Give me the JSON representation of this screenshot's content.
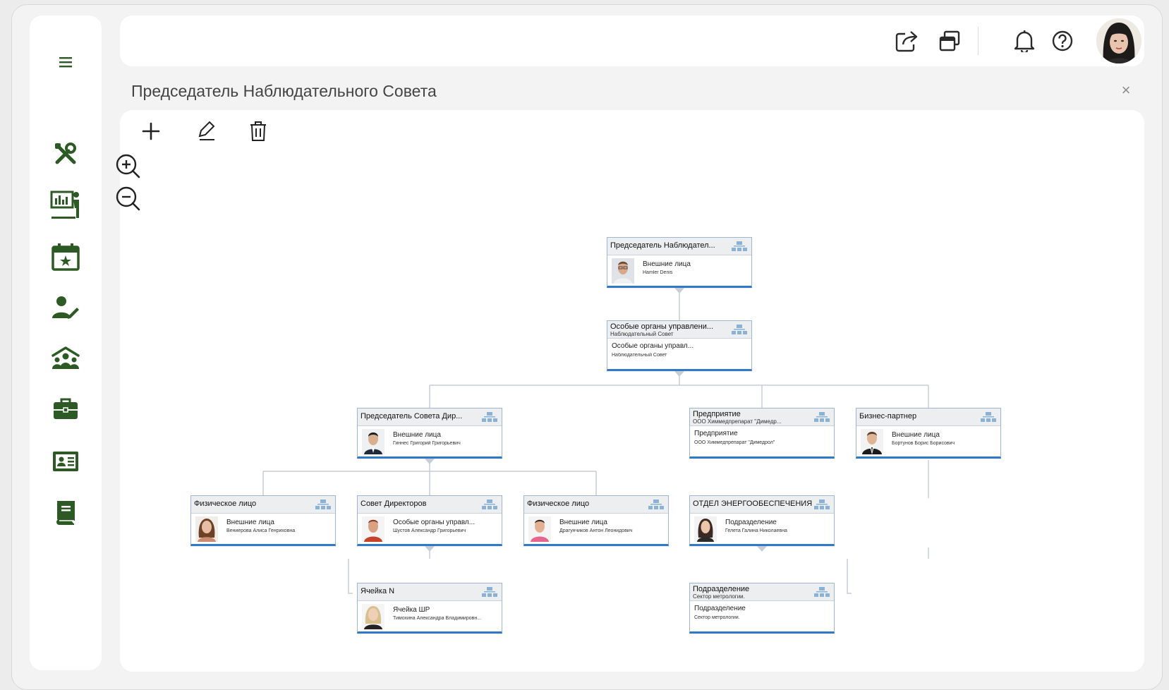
{
  "colors": {
    "icon_green": "#2d5a24",
    "node_border": "#2f79c8",
    "node_header": "#eceeef",
    "connector": "#c5cdd6"
  },
  "sidebar": {
    "items": [
      {
        "icon": "menu-icon"
      },
      {
        "icon": "tools-icon"
      },
      {
        "icon": "presentation-icon"
      },
      {
        "icon": "calendar-star-icon"
      },
      {
        "icon": "user-edit-icon"
      },
      {
        "icon": "organization-icon"
      },
      {
        "icon": "briefcase-icon"
      },
      {
        "icon": "id-card-icon"
      },
      {
        "icon": "book-icon"
      }
    ]
  },
  "topbar": {
    "icons": [
      "share-icon",
      "windows-icon",
      "bell-icon",
      "help-icon"
    ],
    "avatar": "user-avatar"
  },
  "page": {
    "title": "Председатель Наблюдательного Совета",
    "close_icon": "×"
  },
  "toolbar": {
    "icons": [
      "add-icon",
      "edit-icon",
      "delete-icon",
      "zoom-in-icon",
      "zoom-out-icon"
    ]
  },
  "org_chart": {
    "nodes": [
      {
        "id": "chairman-supervisory",
        "title": "Председатель Наблюдател...",
        "subtitle": "",
        "role": "Внешние лица",
        "name": "Hamler Denis",
        "photo": "man-glasses"
      },
      {
        "id": "special-bodies",
        "title": "Особые органы управлени...",
        "subtitle": "Наблюдательный Совет",
        "role": "Особые органы управл...",
        "name": "Наблюдательный Совет",
        "photo": ""
      },
      {
        "id": "chairman-board",
        "title": "Председатель Совета Дир...",
        "subtitle": "",
        "role": "Внешние лица",
        "name": "Гиннес Григорий Григорьевич",
        "photo": "man-asian"
      },
      {
        "id": "enterprise",
        "title": "Предприятие",
        "subtitle": "ООО Химмедпрепарат \"Димедр...",
        "role": "Предприятие",
        "name": "ООО Химмедпрепарат \"Димедрол\"",
        "photo": ""
      },
      {
        "id": "business-partner",
        "title": "Бизнес-партнер",
        "subtitle": "",
        "role": "Внешние лица",
        "name": "Бортунов Борис Борисович",
        "photo": "man-suit"
      },
      {
        "id": "individual-1",
        "title": "Физическое лицо",
        "subtitle": "",
        "role": "Внешние лица",
        "name": "Вениерова Алиса Генриховна",
        "photo": "woman-brunette"
      },
      {
        "id": "board-directors",
        "title": "Совет Директоров",
        "subtitle": "",
        "role": "Особые органы управл...",
        "name": "Шустов Александр Григорьевич",
        "photo": "man-red"
      },
      {
        "id": "individual-2",
        "title": "Физическое лицо",
        "subtitle": "",
        "role": "Внешние лица",
        "name": "Драгунчиков Антон Леонидович",
        "photo": "man-pink"
      },
      {
        "id": "energy-dept",
        "title": "ОТДЕЛ ЭНЕРГООБЕСПЕЧЕНИЯ",
        "subtitle": "",
        "role": "Подразделение",
        "name": "Гелета Галина Николаевна",
        "photo": "woman-dark"
      },
      {
        "id": "cell-n",
        "title": "Ячейка N",
        "subtitle": "",
        "role": "Ячейка ШР",
        "name": "Тимохина Александра Владимировн...",
        "photo": "woman-blonde"
      },
      {
        "id": "subdivision-metrology",
        "title": "Подразделение",
        "subtitle": "Сектор метрологии.",
        "role": "Подразделение",
        "name": "Сектор метрологии.",
        "photo": ""
      }
    ]
  }
}
